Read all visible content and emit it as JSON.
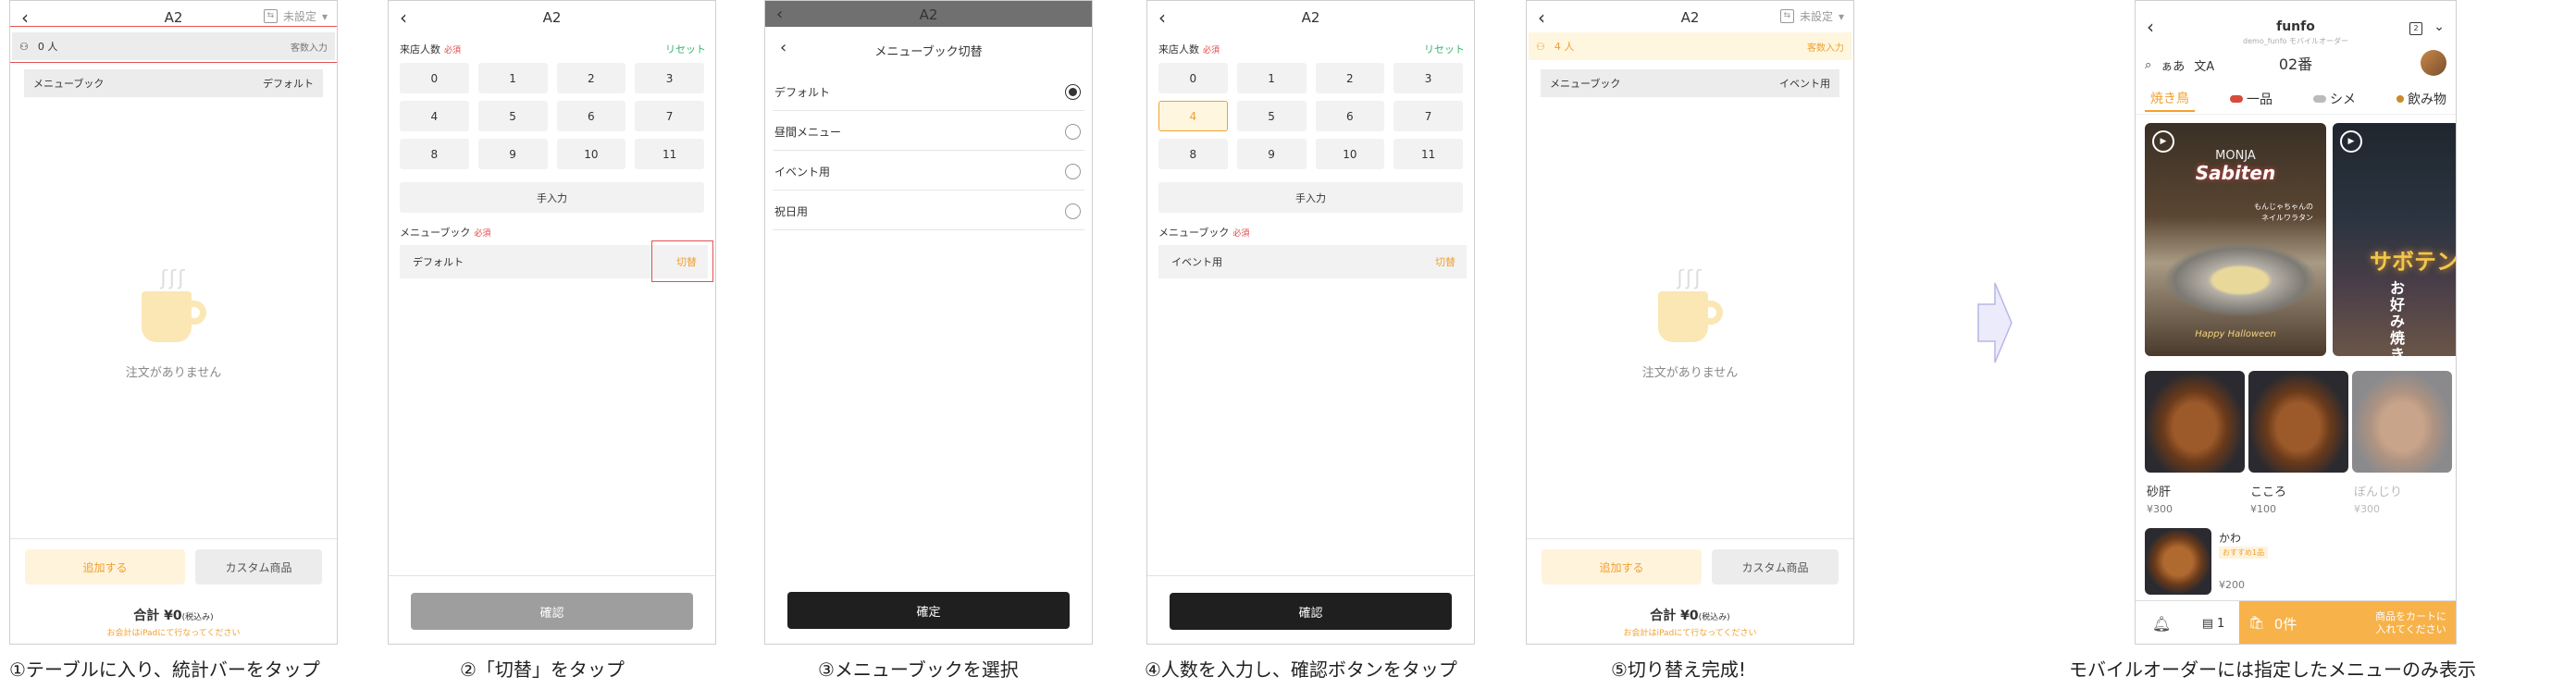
{
  "screen1": {
    "back_icon": "‹",
    "title": "A2",
    "unset_label": "未設定",
    "guests": "0 人",
    "guest_input": "客数入力",
    "menubook_label": "メニューブック",
    "menubook_value": "デフォルト",
    "empty_text": "注文がありません",
    "add_button": "追加する",
    "custom_button": "カスタム商品",
    "total": "合計 ¥0",
    "tax": "(税込み)",
    "note": "お会計はiPadにて行なってください",
    "caption": "①テーブルに入り、統計バーをタップ"
  },
  "screen2": {
    "back_icon": "‹",
    "title": "A2",
    "guests_label": "来店人数",
    "required": "必須",
    "reset": "リセット",
    "keys": [
      "0",
      "1",
      "2",
      "3",
      "4",
      "5",
      "6",
      "7",
      "8",
      "9",
      "10",
      "11"
    ],
    "manual": "手入力",
    "menubook_label": "メニューブック",
    "menubook_required": "必須",
    "menubook_value": "デフォルト",
    "switch": "切替",
    "confirm": "確認",
    "caption": "②「切替」をタップ"
  },
  "screen3": {
    "title": "A2",
    "sheet_title": "メニューブック切替",
    "options": [
      {
        "label": "デフォルト",
        "selected": true
      },
      {
        "label": "昼間メニュー",
        "selected": false
      },
      {
        "label": "イベント用",
        "selected": false
      },
      {
        "label": "祝日用",
        "selected": false
      }
    ],
    "confirm": "確定",
    "caption": "③メニューブックを選択"
  },
  "screen4": {
    "back_icon": "‹",
    "title": "A2",
    "guests_label": "来店人数",
    "required": "必須",
    "reset": "リセット",
    "keys": [
      "0",
      "1",
      "2",
      "3",
      "4",
      "5",
      "6",
      "7",
      "8",
      "9",
      "10",
      "11"
    ],
    "selected_key": "4",
    "manual": "手入力",
    "menubook_label": "メニューブック",
    "menubook_required": "必須",
    "menubook_value": "イベント用",
    "switch": "切替",
    "confirm": "確認",
    "caption": "④人数を入力し、確認ボタンをタップ"
  },
  "screen5": {
    "back_icon": "‹",
    "title": "A2",
    "unset_label": "未設定",
    "guests": "4 人",
    "guest_input": "客数入力",
    "menubook_label": "メニューブック",
    "menubook_value": "イベント用",
    "empty_text": "注文がありません",
    "add_button": "追加する",
    "custom_button": "カスタム商品",
    "total": "合計 ¥0",
    "tax": "(税込み)",
    "note": "お会計はiPadにて行なってください",
    "caption": "⑤切り替え完成!"
  },
  "mobile": {
    "shop_name": "funfo",
    "shop_sub": "demo_funfo モバイルオーダー",
    "table_no": "02番",
    "search_label": "ぁあ",
    "tabs": [
      "焼き鳥",
      "一品",
      "シメ",
      "飲み物"
    ],
    "active_tab": 0,
    "banner1": {
      "top": "MONJA",
      "title": "Sabiten",
      "copy": "もんじゃちゃんの\nネイルワラタン",
      "foot": "Happy Halloween"
    },
    "banner2": {
      "title": "サボテン",
      "vertical": "お好み焼き"
    },
    "items": [
      {
        "name": "砂肝",
        "price": "¥300"
      },
      {
        "name": "こころ",
        "price": "¥100"
      },
      {
        "name": "ぼんじり",
        "price": "¥300"
      }
    ],
    "list_item": {
      "name": "かわ",
      "badge": "おすすめ1品",
      "price": "¥200"
    },
    "history_count": "1",
    "cart_count": "0件",
    "cart_msg": "商品をカートに\n入れてください",
    "caption": "モバイルオーダーには指定したメニューのみ表示"
  },
  "colors": {
    "accent": "#f0a030",
    "highlight": "#e45050",
    "reset": "#3cb371"
  }
}
